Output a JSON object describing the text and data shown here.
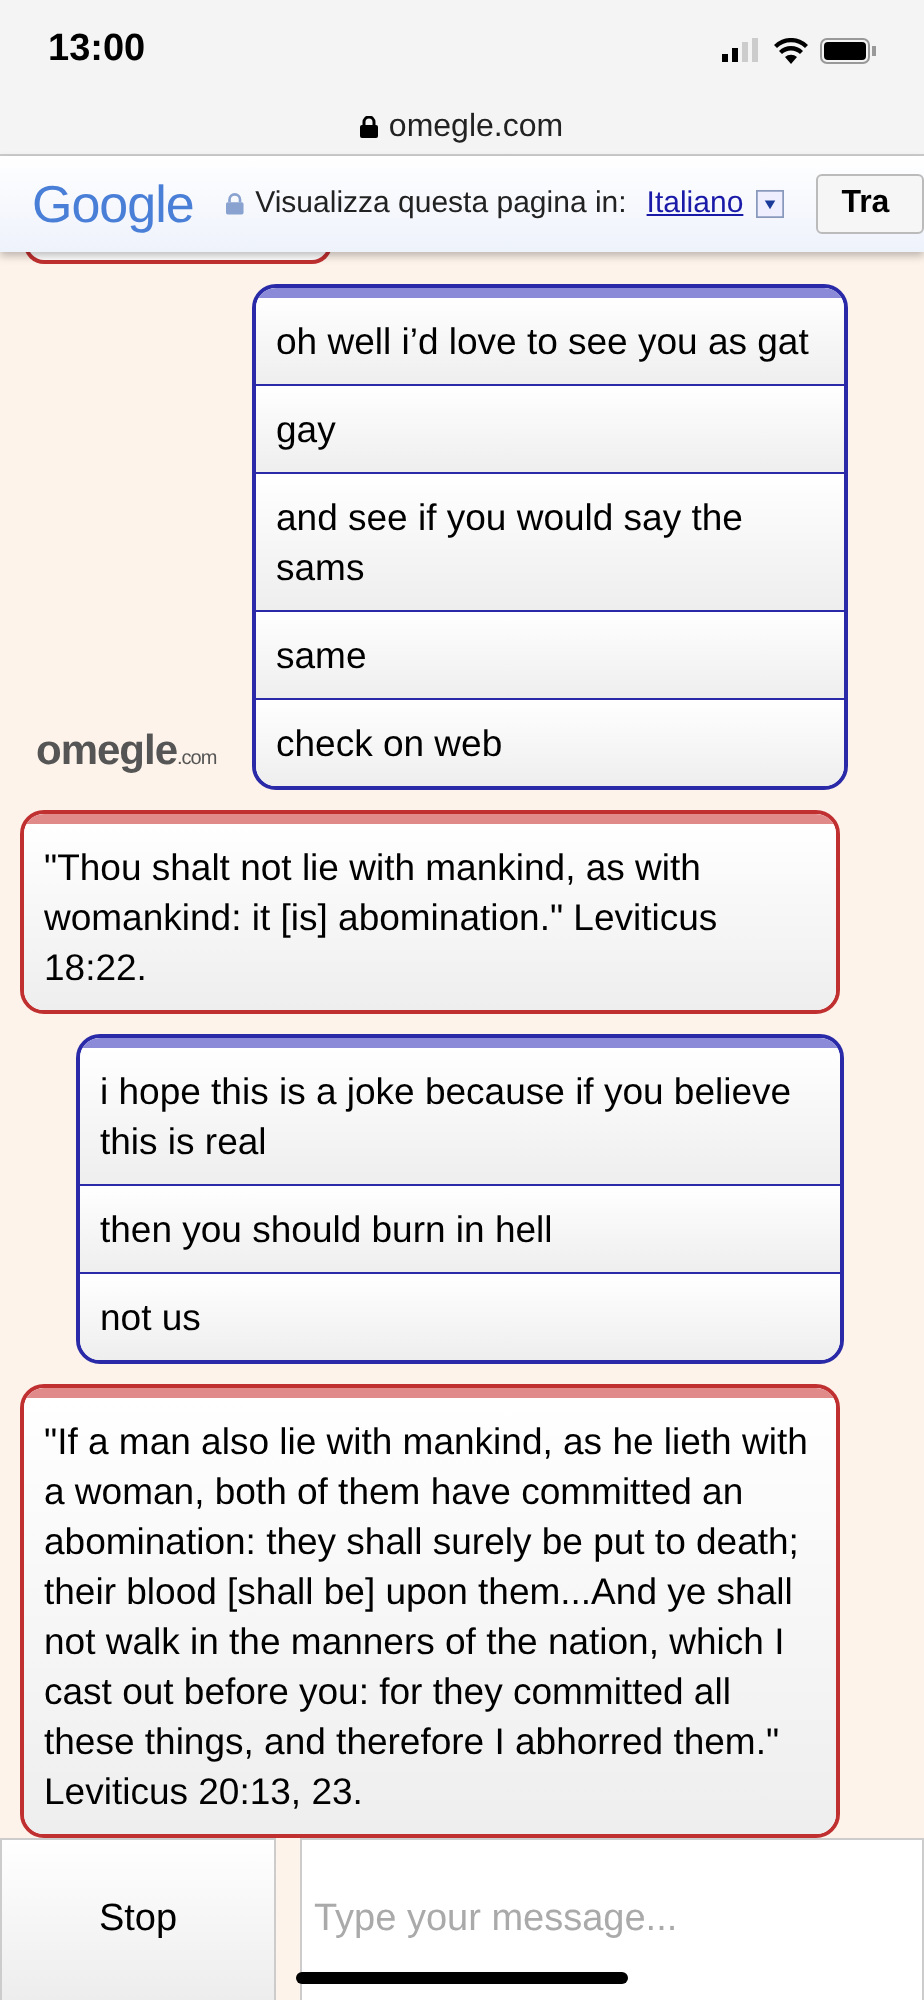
{
  "status_bar": {
    "time": "13:00"
  },
  "address_bar": {
    "url": "omegle.com"
  },
  "translate_bar": {
    "logo": "Google",
    "prompt": "Visualizza questa pagina in:",
    "language": "Italiano",
    "button": "Tra"
  },
  "chat": {
    "logo": "omegle",
    "logo_suffix": ".com",
    "messages": [
      {
        "kind": "stub"
      },
      {
        "kind": "you",
        "lines": [
          "oh well i’d love to see you as gat",
          "gay",
          "and see if you would say the sams",
          "same",
          "check on web"
        ]
      },
      {
        "kind": "stranger",
        "lines": [
          "\"Thou shalt not lie with mankind, as with womankind: it [is] abomination.\" Leviticus 18:22."
        ]
      },
      {
        "kind": "you",
        "lines": [
          "i hope this is a joke because if you believe this is real",
          "then you should burn in hell",
          "not us"
        ]
      },
      {
        "kind": "stranger",
        "lines": [
          "\"If a man also lie with mankind, as he lieth with a woman, both of them have committed an abomination: they shall surely be put to death; their blood [shall be] upon them...And ye shall not walk in the manners of the nation, which I cast out before you: for they committed all these things, and therefore I abhorred them.\" Leviticus 20:13, 23."
        ]
      }
    ]
  },
  "composer": {
    "stop_button": "Stop",
    "placeholder": "Type your message..."
  }
}
